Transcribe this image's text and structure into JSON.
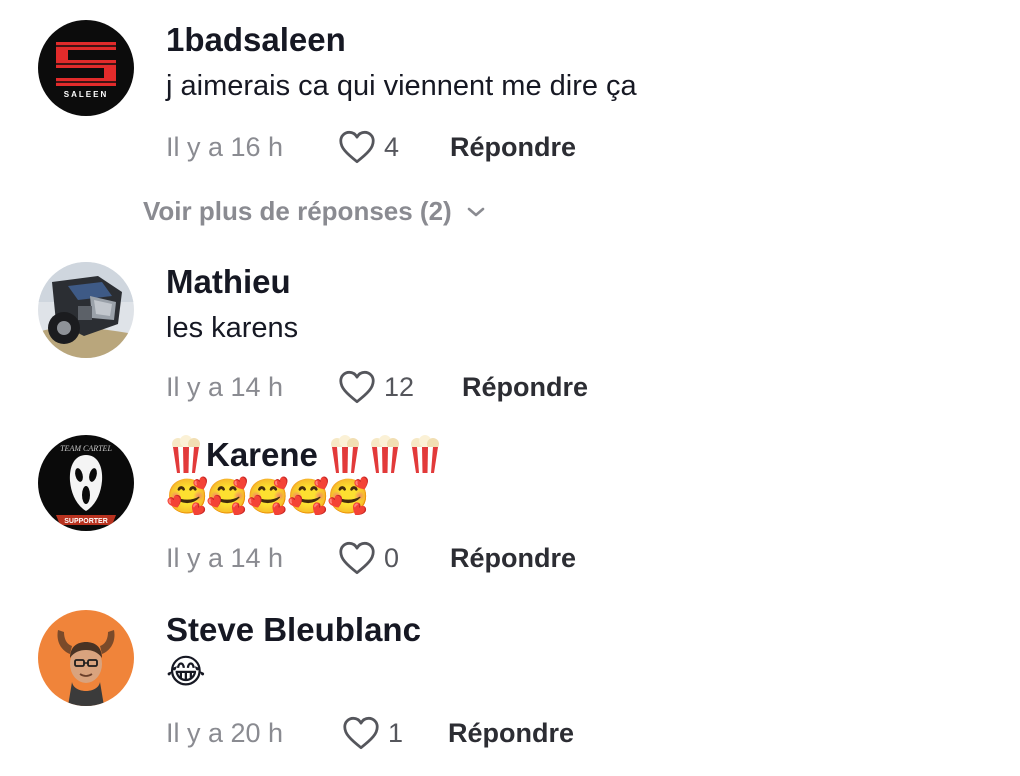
{
  "comments": [
    {
      "username": "1badsaleen",
      "text": "j aimerais ca qui viennent me dire ça",
      "time": "Il y a 16 h",
      "likes": "4",
      "reply_label": "Répondre",
      "avatar_text": "SALEEN"
    },
    {
      "username": "Mathieu",
      "text": "les karens",
      "time": "Il y a 14 h",
      "likes": "12",
      "reply_label": "Répondre"
    },
    {
      "username": "Karene",
      "text": "🥰🥰🥰🥰🥰",
      "time": "Il y a 14 h",
      "likes": "0",
      "reply_label": "Répondre",
      "avatar_text_top": "TEAM CARTEL",
      "avatar_text_bottom": "SUPPORTER"
    },
    {
      "username": "Steve Bleublanc",
      "text": "😂",
      "time": "Il y a 20 h",
      "likes": "1",
      "reply_label": "Répondre"
    }
  ],
  "more_replies": {
    "label": "Voir plus de réponses (2)"
  },
  "colors": {
    "text_primary": "#161823",
    "text_secondary": "#8a8b91",
    "avatar4_bg": "#f0843a"
  },
  "icons": {
    "like": "heart-outline-icon",
    "expand": "chevron-down-icon",
    "username_decoration": "popcorn-icon"
  }
}
